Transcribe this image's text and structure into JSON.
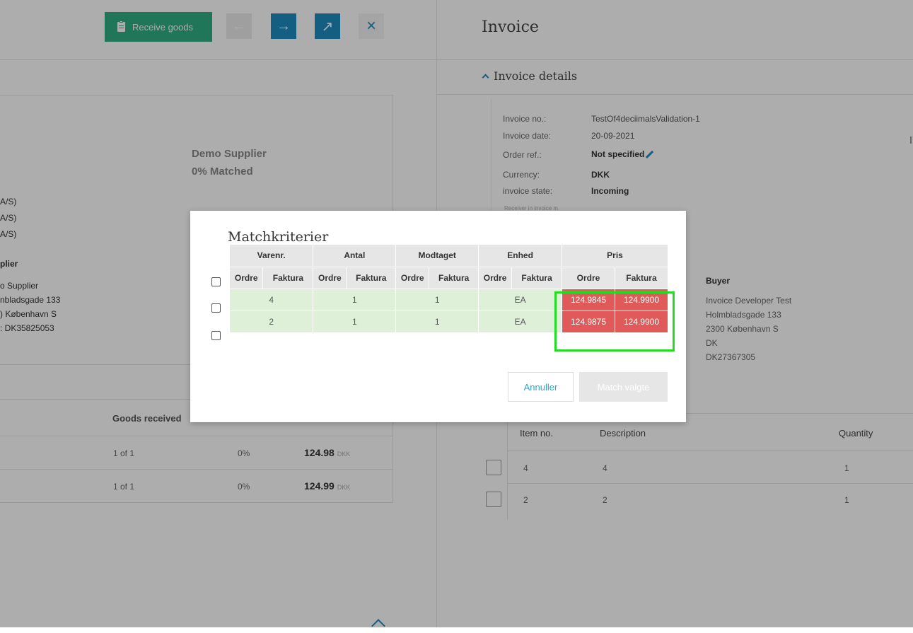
{
  "toolbar": {
    "receive_goods": "Receive goods",
    "back_arrow": "←",
    "forward_arrow": "→",
    "open_arrow": "↗",
    "close": "×"
  },
  "left": {
    "supplier_name": "Demo Supplier",
    "matched": "0% Matched",
    "as_lines": [
      "A/S)",
      "A/S)",
      "A/S)"
    ],
    "supplier_heading": "plier",
    "address": [
      "o Supplier",
      "nbladsgade 133",
      ") København S",
      ": DK35825053"
    ],
    "goods_received_header": "Goods received",
    "rows": [
      {
        "received": "1 of 1",
        "pct": "0%",
        "amount": "124.98",
        "currency": "DKK"
      },
      {
        "received": "1 of 1",
        "pct": "0%",
        "amount": "124.99",
        "currency": "DKK"
      }
    ]
  },
  "invoice": {
    "title": "Invoice",
    "section_title": "Invoice details",
    "fields": [
      {
        "label": "Invoice no.:",
        "value": "TestOf4deciimalsValidation-1"
      },
      {
        "label": "Invoice date:",
        "value": "20-09-2021"
      },
      {
        "label": "Order ref.:",
        "value": "Not specified"
      },
      {
        "label": "Currency:",
        "value": "DKK"
      },
      {
        "label": "invoice state:",
        "value": "Incoming"
      }
    ],
    "receiver_note": "Receiver in invoice m",
    "buyer_heading": "Buyer",
    "buyer_lines": [
      "Invoice Developer Test",
      "Holmbladsgade 133",
      "2300 København S",
      "DK",
      "DK27367305"
    ],
    "lines_headers": {
      "item_no": "Item no.",
      "description": "Description",
      "quantity": "Quantity"
    },
    "lines": [
      {
        "item_no": "4",
        "description": "4",
        "quantity": "1"
      },
      {
        "item_no": "2",
        "description": "2",
        "quantity": "1"
      }
    ]
  },
  "modal": {
    "title": "Matchkriterier",
    "groups": [
      "Varenr.",
      "Antal",
      "Modtaget",
      "Enhed",
      "Pris"
    ],
    "sub": [
      "Ordre",
      "Faktura",
      "Ordre",
      "Faktura",
      "Ordre",
      "Faktura",
      "Ordre",
      "Faktura",
      "Ordre",
      "Faktura"
    ],
    "rows": [
      {
        "varenr": "4",
        "antal": "1",
        "modtaget": "1",
        "enhed": "EA",
        "pris_ordre": "124.9845",
        "pris_faktura": "124.9900"
      },
      {
        "varenr": "2",
        "antal": "1",
        "modtaget": "1",
        "enhed": "EA",
        "pris_ordre": "124.9875",
        "pris_faktura": "124.9900"
      }
    ],
    "cancel": "Annuller",
    "match": "Match valgte"
  },
  "colors": {
    "green": "#2eae84",
    "blue": "#1e8bbf",
    "red": "#e05a5a",
    "highlight": "#22dd22",
    "accent_text": "#2aa7c9"
  }
}
